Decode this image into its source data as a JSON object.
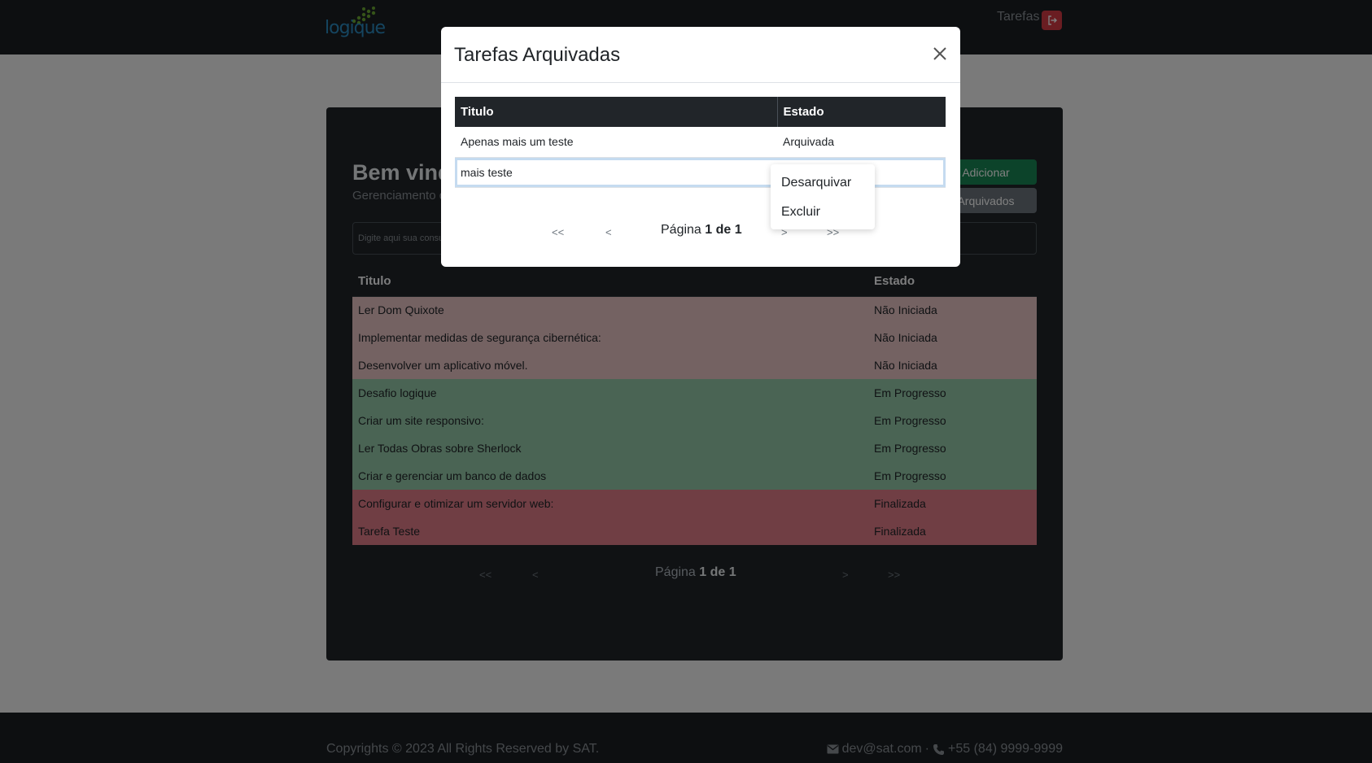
{
  "navbar": {
    "logo_text": "logique",
    "nav_link": "Tarefas",
    "logout_icon": "logout-icon"
  },
  "main": {
    "welcome_title": "Bem vindo",
    "welcome_subtitle": "Gerenciamento de Tarefas",
    "add_button": "Adicionar",
    "archived_button": "Arquivados",
    "search_placeholder": "Digite aqui sua consulta",
    "table": {
      "headers": [
        "Titulo",
        "Estado"
      ],
      "rows": [
        {
          "titulo": "Ler Dom Quixote",
          "estado": "Não Iniciada"
        },
        {
          "titulo": "Implementar medidas de segurança cibernética:",
          "estado": "Não Iniciada"
        },
        {
          "titulo": "Desenvolver um aplicativo móvel.",
          "estado": "Não Iniciada"
        },
        {
          "titulo": "Desafio logique",
          "estado": "Em Progresso"
        },
        {
          "titulo": "Criar um site responsivo:",
          "estado": "Em Progresso"
        },
        {
          "titulo": "Ler Todas Obras sobre Sherlock",
          "estado": "Em Progresso"
        },
        {
          "titulo": "Criar e gerenciar um banco de dados",
          "estado": "Em Progresso"
        },
        {
          "titulo": "Configurar e otimizar um servidor web:",
          "estado": "Finalizada"
        },
        {
          "titulo": "Tarefa Teste",
          "estado": "Finalizada"
        }
      ]
    },
    "pager": {
      "first": "<<",
      "prev": "<",
      "label": "Página",
      "current": "1",
      "of": "de",
      "total": "1",
      "next": ">",
      "last": ">>"
    }
  },
  "modal": {
    "title": "Tarefas Arquivadas",
    "close_icon": "close-icon",
    "table": {
      "headers": [
        "Titulo",
        "Estado"
      ],
      "rows": [
        {
          "titulo": "Apenas mais um teste",
          "estado": "Arquivada"
        },
        {
          "titulo": "mais teste",
          "estado": ""
        }
      ]
    },
    "pager": {
      "first": "<<",
      "prev": "<",
      "label": "Página",
      "current": "1",
      "of": "de",
      "total": "1",
      "next": ">",
      "last": ">>"
    },
    "context_menu": {
      "items": [
        "Desarquivar",
        "Excluir"
      ]
    }
  },
  "footer": {
    "copyright": "Copyrights © 2023 All Rights Reserved by SAT.",
    "email": "dev@sat.com",
    "separator": "·",
    "phone": "+55 (84) 9999-9999"
  },
  "colors": {
    "nao_iniciada": "#e8c4c4",
    "em_progresso": "#95c9a8",
    "finalizada": "#e07c88",
    "add_button": "#198754",
    "logout_button": "#d43a45"
  }
}
